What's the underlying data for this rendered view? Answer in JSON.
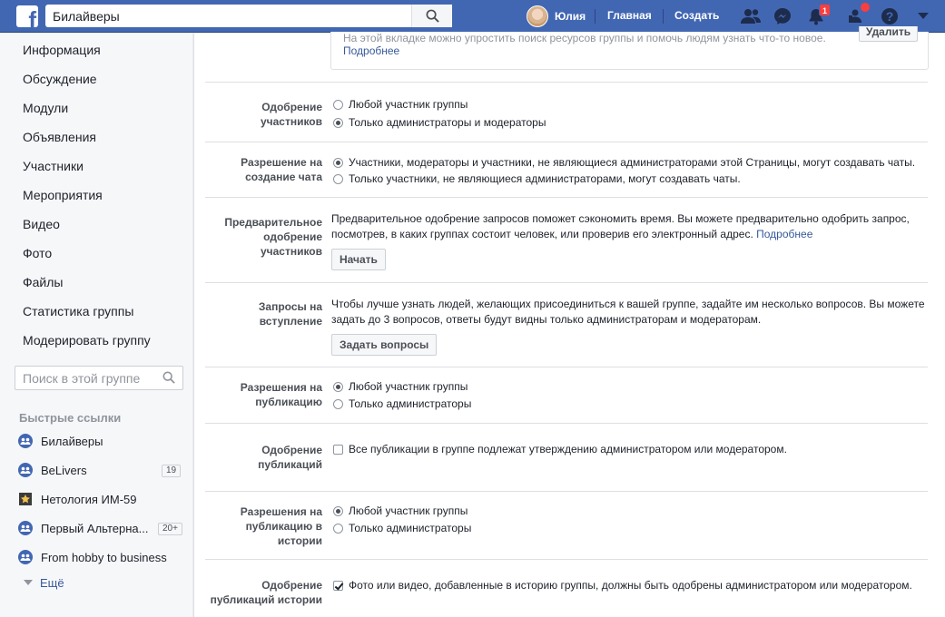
{
  "topbar": {
    "search_value": "Билайверы",
    "user_name": "Юлия",
    "home_label": "Главная",
    "create_label": "Создать",
    "notifications_count": "1",
    "colors": {
      "bar": "#4267b2",
      "badge": "#fa3e3e"
    }
  },
  "sidebar": {
    "items": [
      "Информация",
      "Обсуждение",
      "Модули",
      "Объявления",
      "Участники",
      "Мероприятия",
      "Видео",
      "Фото",
      "Файлы",
      "Статистика группы",
      "Модерировать группу"
    ],
    "search_placeholder": "Поиск в этой группе",
    "quick_links_title": "Быстрые ссылки",
    "quick_links": [
      {
        "label": "Билайверы",
        "icon": "group-icon",
        "count": ""
      },
      {
        "label": "BeLivers",
        "icon": "group-icon",
        "count": "19"
      },
      {
        "label": "Нетология ИМ-59",
        "icon": "star-icon",
        "count": ""
      },
      {
        "label": "Первый Альтерна...",
        "icon": "group-icon",
        "count": "20+"
      },
      {
        "label": "From hobby to business",
        "icon": "group-icon",
        "count": ""
      }
    ],
    "more_label": "Ещё"
  },
  "main": {
    "top_box": {
      "text": "На этой вкладке можно упростить поиск ресурсов группы и помочь людям узнать что-то новое.",
      "link": "Подробнее",
      "button": "Удалить"
    },
    "membership_approval": {
      "label_line1": "Одобрение",
      "label_line2": "участников",
      "options": [
        "Любой участник группы",
        "Только администраторы и модераторы"
      ],
      "selected": 1
    },
    "chat_permission": {
      "label_line1": "Разрешение на",
      "label_line2": "создание чата",
      "options": [
        "Участники, модераторы и участники, не являющиеся администраторами этой Страницы, могут создавать чаты.",
        "Только участники, не являющиеся администраторами, могут создавать чаты."
      ],
      "selected": 0
    },
    "pre_approval": {
      "label_line1": "Предварительное",
      "label_line2": "одобрение",
      "label_line3": "участников",
      "text_line1": "Предварительное одобрение запросов поможет сэкономить время. Вы можете предварительно одобрить запрос,",
      "text_line2": "посмотрев, в каких группах состоит человек, или проверив его электронный адрес.",
      "link": "Подробнее",
      "button": "Начать"
    },
    "membership_questions": {
      "label_line1": "Запросы на",
      "label_line2": "вступление",
      "text_line1": "Чтобы лучше узнать людей, желающих присоединиться к вашей группе, задайте им несколько вопросов. Вы можете",
      "text_line2": "задать до 3 вопросов, ответы будут видны только администраторам и модераторам.",
      "button": "Задать вопросы"
    },
    "post_permission": {
      "label_line1": "Разрешения на",
      "label_line2": "публикацию",
      "options": [
        "Любой участник группы",
        "Только администраторы"
      ],
      "selected": 0
    },
    "post_approval": {
      "label_line1": "Одобрение",
      "label_line2": "публикаций",
      "option": "Все публикации в группе подлежат утверждению администратором или модератором.",
      "checked": false
    },
    "story_permission": {
      "label_line1": "Разрешения на",
      "label_line2": "публикацию в",
      "label_line3": "истории",
      "options": [
        "Любой участник группы",
        "Только администраторы"
      ],
      "selected": 0
    },
    "story_approval": {
      "label_line1": "Одобрение",
      "label_line2": "публикаций истории",
      "option": "Фото или видео, добавленные в историю группы, должны быть одобрены администратором или модератором.",
      "checked": true
    }
  }
}
